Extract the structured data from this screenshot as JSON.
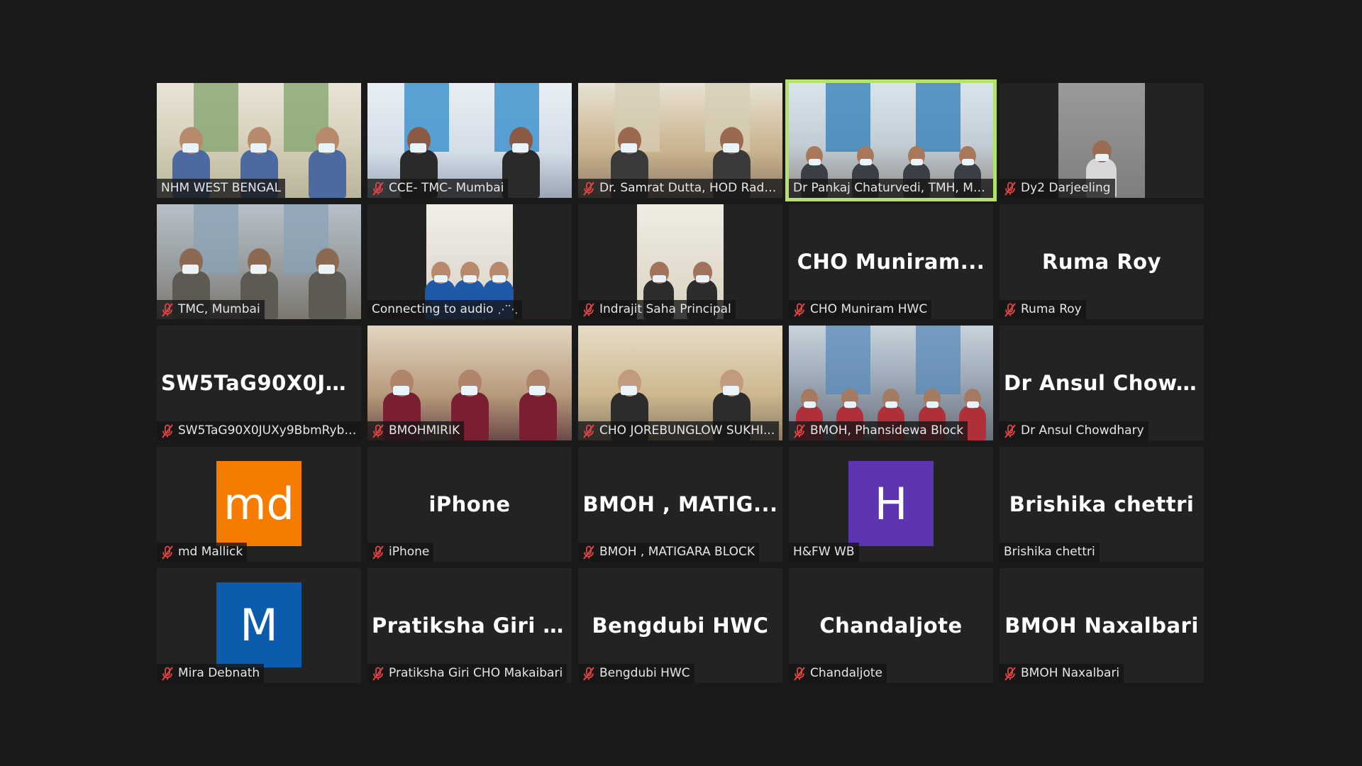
{
  "tiles": [
    {
      "label": "NHM WEST BENGAL",
      "muted": false,
      "kind": "video",
      "scene": "room",
      "wide": true
    },
    {
      "label": "CCE- TMC- Mumbai",
      "muted": true,
      "kind": "video",
      "scene": "blue",
      "wide": true
    },
    {
      "label": "Dr. Samrat Dutta,  HOD Radi...",
      "muted": true,
      "kind": "video",
      "scene": "boxes",
      "wide": true
    },
    {
      "label": "Dr Pankaj Chaturvedi, TMH, Mu...",
      "muted": false,
      "kind": "video",
      "scene": "speaker",
      "wide": true,
      "active": true
    },
    {
      "label": "Dy2 Darjeeling",
      "muted": true,
      "kind": "video",
      "scene": "grey",
      "wide": false
    },
    {
      "label": "TMC, Mumbai",
      "muted": true,
      "kind": "video",
      "scene": "dim",
      "wide": true
    },
    {
      "label": "Connecting to audio",
      "muted": false,
      "kind": "video",
      "scene": "selfie",
      "wide": false,
      "connecting": true
    },
    {
      "label": "Indrajit Saha Principal",
      "muted": true,
      "kind": "video",
      "scene": "office",
      "wide": false
    },
    {
      "label": "CHO Muniram HWC",
      "muted": true,
      "kind": "name",
      "bigname": "CHO  Muniram..."
    },
    {
      "label": "Ruma Roy",
      "muted": true,
      "kind": "name",
      "bigname": "Ruma Roy"
    },
    {
      "label": "SW5TaG90X0JUXy9BbmRyb2...",
      "muted": true,
      "kind": "name",
      "bigname": "SW5TaG90X0JU..."
    },
    {
      "label": "BMOHMIRIK",
      "muted": true,
      "kind": "video",
      "scene": "store",
      "wide": true
    },
    {
      "label": "CHO  JOREBUNGLOW SUKHI...",
      "muted": true,
      "kind": "video",
      "scene": "pair",
      "wide": true
    },
    {
      "label": "BMOH, Phansidewa Block",
      "muted": true,
      "kind": "video",
      "scene": "crowd",
      "wide": true
    },
    {
      "label": "Dr Ansul Chowdhary",
      "muted": true,
      "kind": "name",
      "bigname": "Dr  Ansul  Chow..."
    },
    {
      "label": "md Mallick",
      "muted": true,
      "kind": "avatar",
      "avatar_text": "md",
      "avatar_color": "#f57c00"
    },
    {
      "label": "iPhone",
      "muted": true,
      "kind": "name",
      "bigname": "iPhone"
    },
    {
      "label": "BMOH , MATIGARA BLOCK",
      "muted": true,
      "kind": "name",
      "bigname": "BMOH  ,  MATIG..."
    },
    {
      "label": "H&FW WB",
      "muted": false,
      "kind": "avatar",
      "avatar_text": "H",
      "avatar_color": "#5e35b1"
    },
    {
      "label": "Brishika chettri",
      "muted": false,
      "kind": "name",
      "bigname": "Brishika  chettri"
    },
    {
      "label": "Mira Debnath",
      "muted": true,
      "kind": "avatar",
      "avatar_text": "M",
      "avatar_color": "#0b5cad"
    },
    {
      "label": "Pratiksha Giri CHO Makaibari",
      "muted": true,
      "kind": "name",
      "bigname": "Pratiksha  Giri  C..."
    },
    {
      "label": "Bengdubi HWC",
      "muted": true,
      "kind": "name",
      "bigname": "Bengdubi HWC"
    },
    {
      "label": "Chandaljote",
      "muted": true,
      "kind": "name",
      "bigname": "Chandaljote"
    },
    {
      "label": "BMOH Naxalbari",
      "muted": true,
      "kind": "name",
      "bigname": "BMOH Naxalbari"
    }
  ],
  "colors": {
    "background": "#1a1a1a",
    "tile": "#232323",
    "active_border": "#b5e26a",
    "mute_icon": "#e04444"
  }
}
